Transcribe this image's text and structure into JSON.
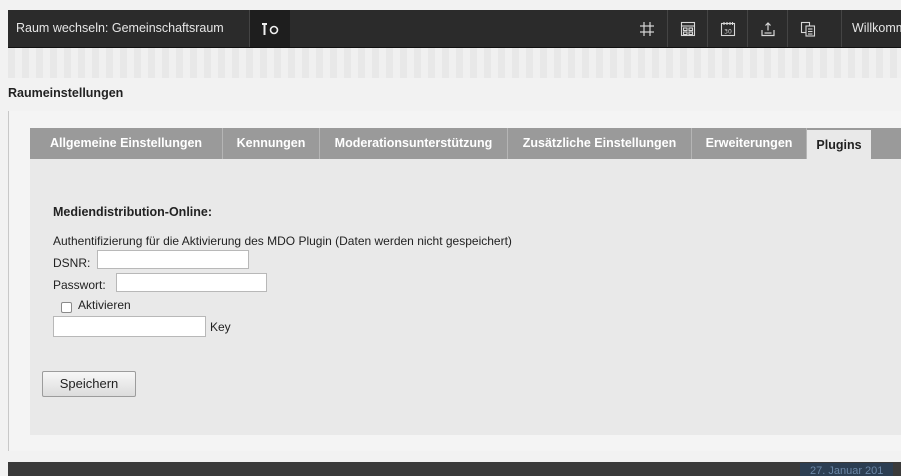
{
  "topbar": {
    "room_switch_label": "Raum wechseln: Gemeinschaftsraum",
    "welcome": "Willkommen",
    "icons": [
      "settings-tools-icon",
      "grid-icon",
      "layout-icon",
      "calendar-icon",
      "upload-icon",
      "copy-icon"
    ]
  },
  "page": {
    "title": "Raumeinstellungen"
  },
  "tabs": [
    {
      "label": "Allgemeine Einstellungen",
      "active": false
    },
    {
      "label": "Kennungen",
      "active": false
    },
    {
      "label": "Moderationsunterstützung",
      "active": false
    },
    {
      "label": "Zusätzliche Einstellungen",
      "active": false
    },
    {
      "label": "Erweiterungen",
      "active": false
    },
    {
      "label": "Plugins",
      "active": true
    }
  ],
  "plugin": {
    "section_title": "Mediendistribution-Online:",
    "description": "Authentifizierung für die Aktivierung des MDO Plugin (Daten werden nicht gespeichert)",
    "dsnr_label": "DSNR:",
    "dsnr_value": "",
    "password_label": "Passwort:",
    "password_value": "",
    "activate_label": "Aktivieren",
    "activate_checked": false,
    "key_value": "",
    "key_label": "Key",
    "save_label": "Speichern"
  },
  "footer": {
    "date": "27. Januar 201"
  },
  "colors": {
    "topbar": "#2b2b2b",
    "tab_inactive": "#9a9a9a",
    "content_bg": "#e9e9e9"
  }
}
